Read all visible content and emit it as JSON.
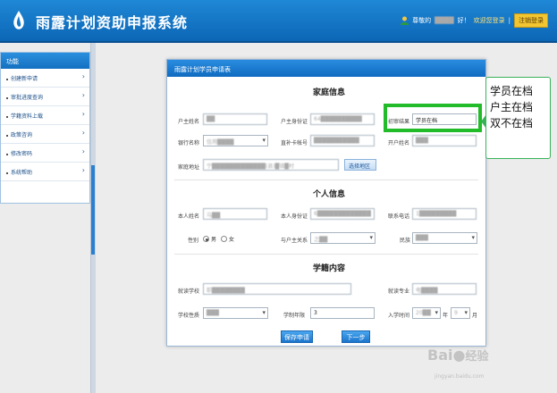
{
  "header": {
    "title": "雨露计划资助申报系统",
    "user_greeting": "尊敬的",
    "user_name": "████",
    "user_suffix": "好！",
    "welcome": "欢迎您登录",
    "logout": "注销登录"
  },
  "sidebar": {
    "title": "功能",
    "items": [
      {
        "label": "创建新申请"
      },
      {
        "label": "审批进度查询"
      },
      {
        "label": "学籍资料上载"
      },
      {
        "label": "政策咨询"
      },
      {
        "label": "修改密码"
      },
      {
        "label": "系统帮助"
      }
    ]
  },
  "dialog": {
    "title": "雨露计划学员申请表",
    "family_section": "家庭信息",
    "personal_section": "个人信息",
    "school_section": "学籍内容",
    "fields": {
      "householder_name": {
        "label": "户主姓名",
        "value": "██"
      },
      "householder_id": {
        "label": "户主身份证",
        "value": "64██████████"
      },
      "screening_result": {
        "label": "初审结果",
        "value": "学员在档"
      },
      "bank_name": {
        "label": "银行名称",
        "value": "信用████"
      },
      "card_number": {
        "label": "直补卡帐号",
        "value": "███████████"
      },
      "account_holder": {
        "label": "开户姓名",
        "value": "███"
      },
      "home_address": {
        "label": "家庭地址",
        "value": "宁█████████████(县)█镇█村"
      },
      "select_area_btn": "选择地区",
      "my_name": {
        "label": "本人姓名",
        "value": "马██"
      },
      "my_id": {
        "label": "本人身份证",
        "value": "6█████████████"
      },
      "phone": {
        "label": "联系电话",
        "value": "1█████████"
      },
      "gender": {
        "label": "性别",
        "male": "男",
        "female": "女",
        "selected": "male"
      },
      "relation": {
        "label": "与户主关系",
        "value": "之██"
      },
      "ethnicity": {
        "label": "民族",
        "value": "███"
      },
      "school": {
        "label": "就读学校",
        "value": "职████████"
      },
      "major": {
        "label": "就读专业",
        "value": "电████"
      },
      "school_type": {
        "label": "学校性质",
        "value": "███"
      },
      "duration": {
        "label": "学制年限",
        "value": "3"
      },
      "enroll_time": {
        "label": "入学时间",
        "year": "20██",
        "year_unit": "年",
        "month": "9",
        "month_unit": "月"
      }
    },
    "save_button": "保存申请",
    "next_button": "下一步"
  },
  "callout": {
    "lines": [
      "学员在档",
      "户主在档",
      "双不在档"
    ]
  },
  "watermark": {
    "brand": "Bai",
    "brand_cn": "经验",
    "url": "jingyan.baidu.com"
  },
  "colors": {
    "header": "#1579c9",
    "highlight": "#22bb2a",
    "button": "#2a86d8"
  }
}
